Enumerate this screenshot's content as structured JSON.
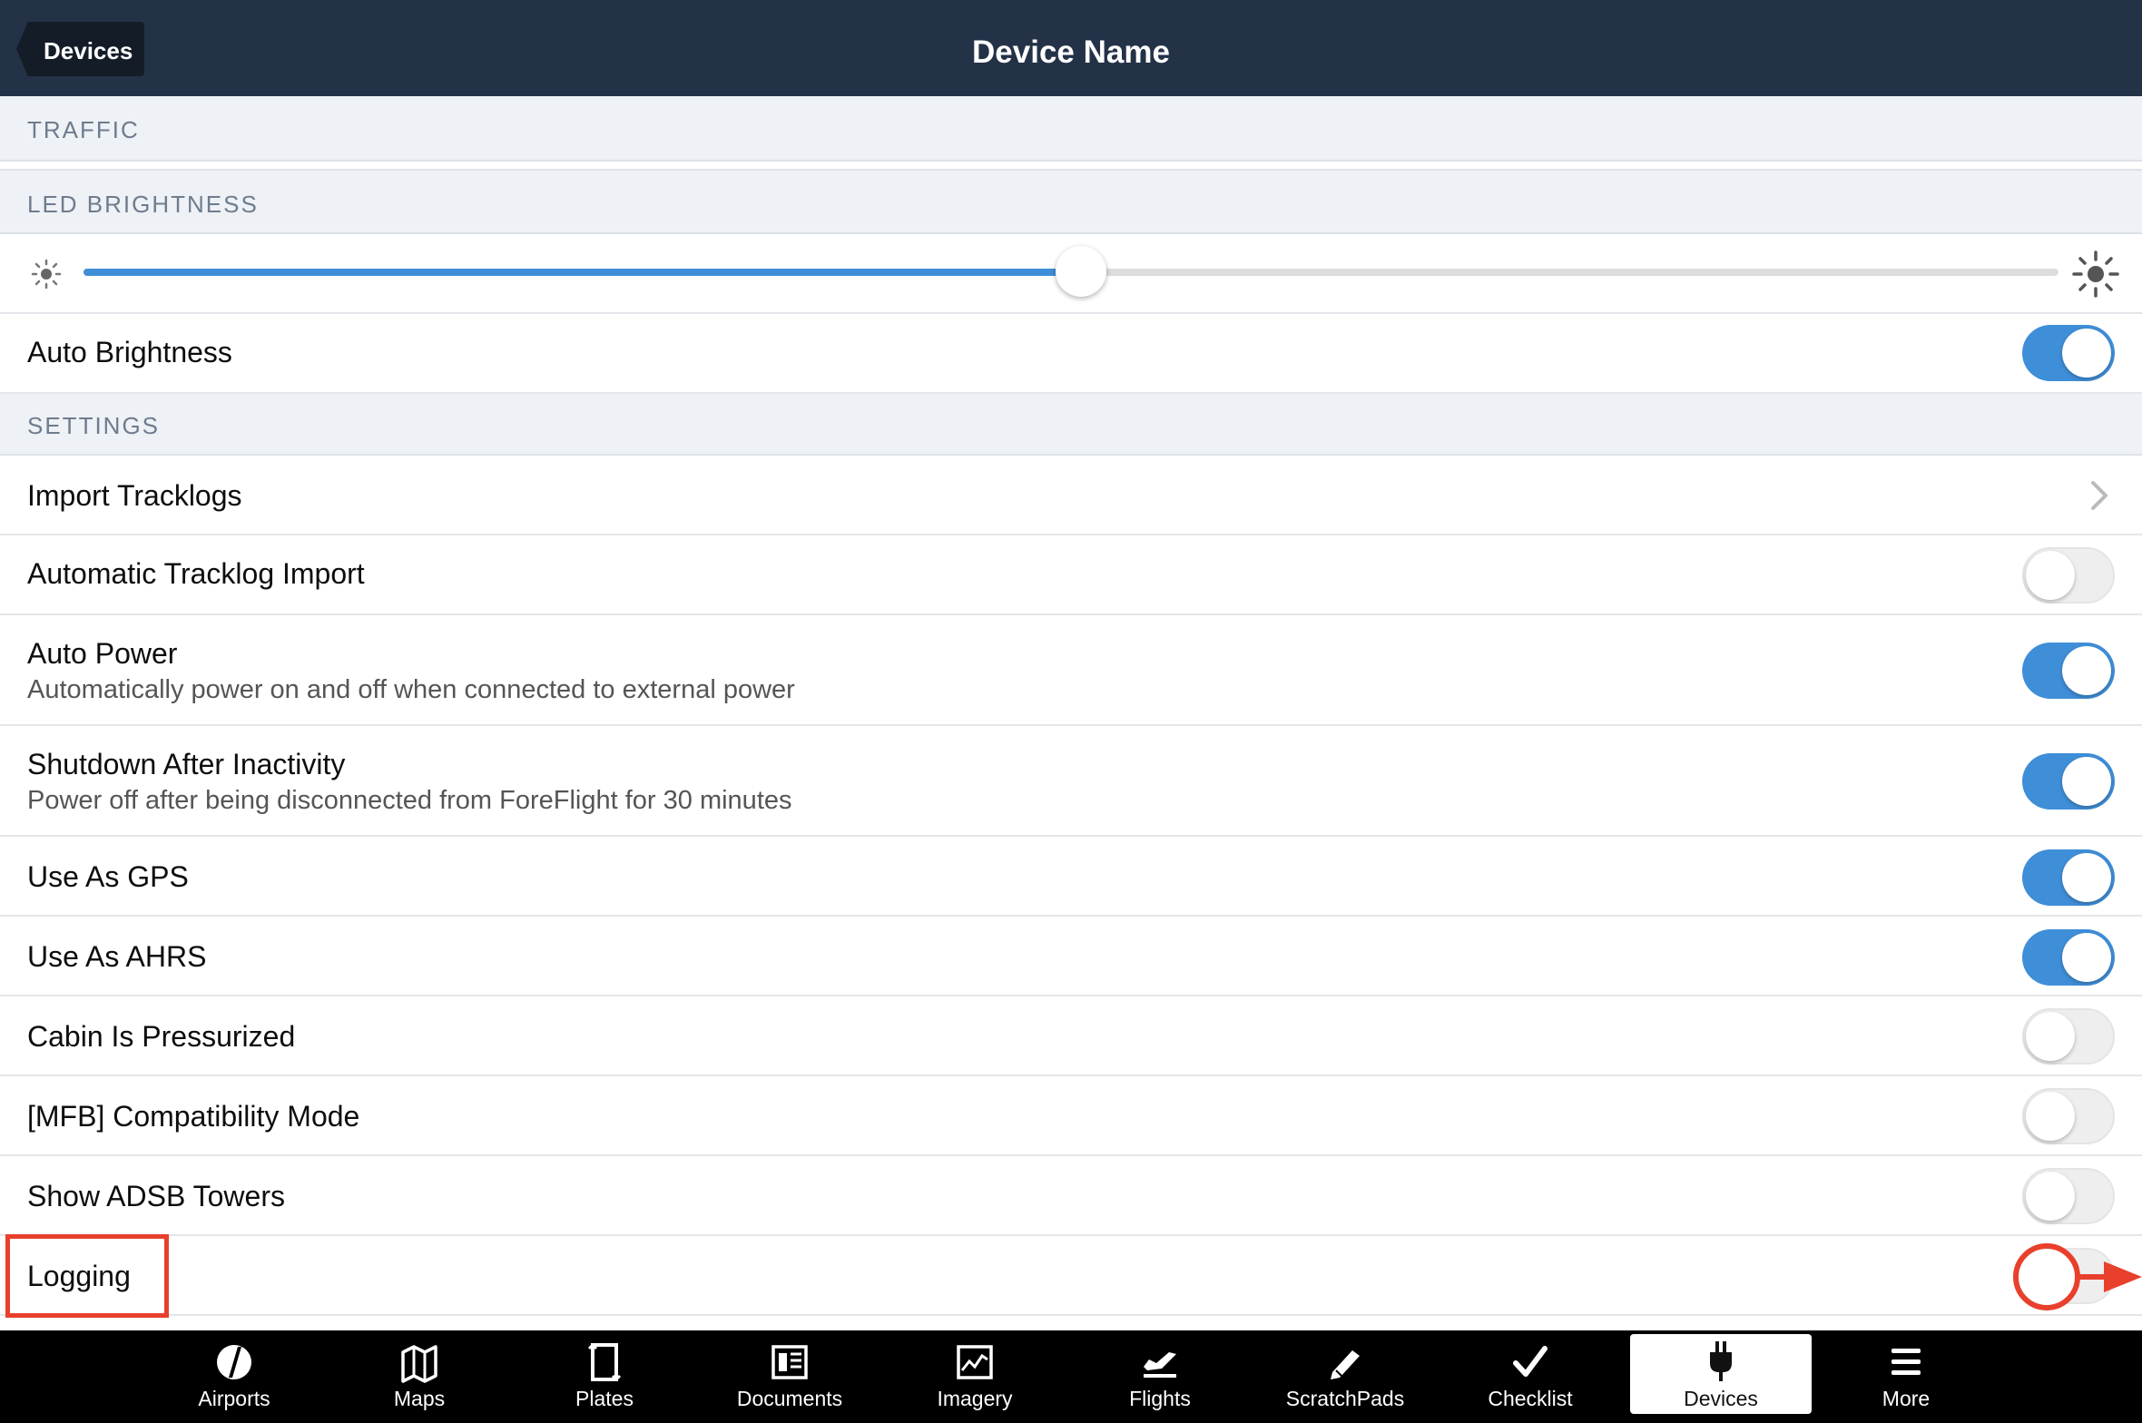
{
  "header": {
    "back_label": "Devices",
    "title": "Device Name"
  },
  "sections": {
    "traffic": "TRAFFIC",
    "led_brightness": "LED BRIGHTNESS",
    "settings": "SETTINGS"
  },
  "brightness": {
    "level": 0.505
  },
  "rows": {
    "auto_brightness": {
      "label": "Auto Brightness",
      "on": true
    },
    "import_tracklogs": {
      "label": "Import Tracklogs"
    },
    "automatic_tracklog_import": {
      "label": "Automatic Tracklog Import",
      "on": false
    },
    "auto_power": {
      "label": "Auto Power",
      "sub": "Automatically power on and off when connected to external power",
      "on": true
    },
    "shutdown_after_inactivity": {
      "label": "Shutdown After Inactivity",
      "sub": "Power off after being disconnected from ForeFlight for 30 minutes",
      "on": true
    },
    "use_as_gps": {
      "label": "Use As GPS",
      "on": true
    },
    "use_as_ahrs": {
      "label": "Use As AHRS",
      "on": true
    },
    "cabin_is_pressurized": {
      "label": "Cabin Is Pressurized",
      "on": false
    },
    "mfb_compatibility_mode": {
      "label": "[MFB] Compatibility Mode",
      "on": false
    },
    "show_adsb_towers": {
      "label": "Show ADSB Towers",
      "on": false
    },
    "logging": {
      "label": "Logging",
      "on": false
    }
  },
  "tabs": [
    {
      "label": "Airports",
      "icon": "airports-icon"
    },
    {
      "label": "Maps",
      "icon": "maps-icon"
    },
    {
      "label": "Plates",
      "icon": "plates-icon"
    },
    {
      "label": "Documents",
      "icon": "documents-icon"
    },
    {
      "label": "Imagery",
      "icon": "imagery-icon"
    },
    {
      "label": "Flights",
      "icon": "flights-icon"
    },
    {
      "label": "ScratchPads",
      "icon": "scratchpads-icon"
    },
    {
      "label": "Checklist",
      "icon": "checklist-icon"
    },
    {
      "label": "Devices",
      "icon": "devices-icon",
      "active": true
    },
    {
      "label": "More",
      "icon": "more-icon"
    }
  ],
  "colors": {
    "navbar": "#243248",
    "accent": "#3f8ed8",
    "annotation": "#e8402c"
  }
}
